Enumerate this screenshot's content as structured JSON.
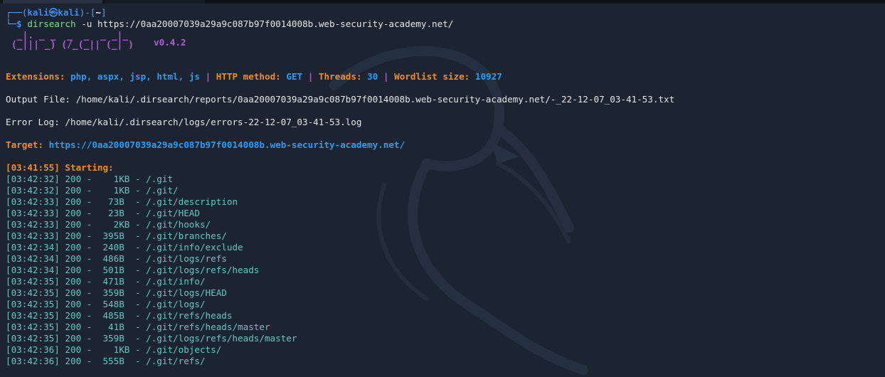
{
  "prompt": {
    "corner_top": "┌──(",
    "user": "kali",
    "at": "㉿",
    "host": "kali",
    "close": ")-[",
    "dir": "~",
    "close2": "]",
    "corner_bottom": "└─",
    "dollar": "$",
    "command": "dirsearch",
    "args": "-u https://0aa20007039a29a9c087b97f0014008b.web-security-academy.net/"
  },
  "banner": {
    "art_line1": "  _|. _ _  _  _  _ _|_",
    "art_line2": " (_||| _) (/_(_|| (_| )",
    "version": "v0.4.2"
  },
  "config": {
    "extensions_label": "Extensions:",
    "extensions_value": "php, aspx, jsp, html, js",
    "sep": "|",
    "method_label": "HTTP method:",
    "method_value": "GET",
    "threads_label": "Threads:",
    "threads_value": "30",
    "wordlist_label": "Wordlist size:",
    "wordlist_value": "10927"
  },
  "output_file": "Output File: /home/kali/.dirsearch/reports/0aa20007039a29a9c087b97f0014008b.web-security-academy.net/-_22-12-07_03-41-53.txt",
  "error_log": "Error Log: /home/kali/.dirsearch/logs/errors-22-12-07_03-41-53.log",
  "target": {
    "label": "Target:",
    "url": "https://0aa20007039a29a9c087b97f0014008b.web-security-academy.net/"
  },
  "starting": "[03:41:55] Starting:",
  "results": [
    "[03:42:32] 200 -    1KB - /.git",
    "[03:42:32] 200 -    1KB - /.git/",
    "[03:42:33] 200 -   73B  - /.git/description",
    "[03:42:33] 200 -   23B  - /.git/HEAD",
    "[03:42:33] 200 -    2KB - /.git/hooks/",
    "[03:42:33] 200 -  395B  - /.git/branches/",
    "[03:42:34] 200 -  240B  - /.git/info/exclude",
    "[03:42:34] 200 -  486B  - /.git/logs/refs",
    "[03:42:34] 200 -  501B  - /.git/logs/refs/heads",
    "[03:42:35] 200 -  471B  - /.git/info/",
    "[03:42:35] 200 -  359B  - /.git/logs/HEAD",
    "[03:42:35] 200 -  548B  - /.git/logs/",
    "[03:42:35] 200 -  485B  - /.git/refs/heads",
    "[03:42:35] 200 -   41B  - /.git/refs/heads/master",
    "[03:42:35] 200 -  359B  - /.git/logs/refs/heads/master",
    "[03:42:36] 200 -    1KB - /.git/objects/",
    "[03:42:36] 200 -  555B  - /.git/refs/"
  ]
}
